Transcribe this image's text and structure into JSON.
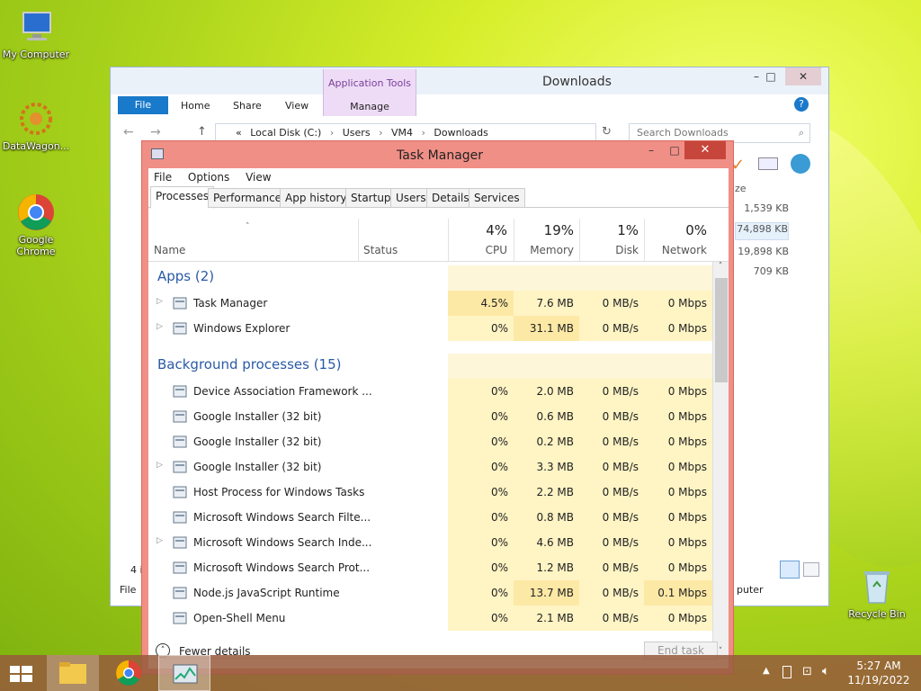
{
  "desktop": {
    "icons": [
      {
        "label": "My Computer"
      },
      {
        "label": "DataWagon..."
      },
      {
        "label": "Google Chrome"
      },
      {
        "label": "Recycle Bin"
      }
    ]
  },
  "explorer": {
    "title": "Downloads",
    "contextual_tab": "Application Tools",
    "tabs": [
      "File",
      "Home",
      "Share",
      "View",
      "Manage"
    ],
    "address": {
      "prefix": "«",
      "crumbs": [
        "Local Disk (C:)",
        "Users",
        "VM4",
        "Downloads"
      ]
    },
    "search_placeholder": "Search Downloads",
    "size_header": "ze",
    "sizes": [
      "1,539 KB",
      "74,898 KB",
      "19,898 KB",
      "709 KB"
    ],
    "status_count": "4 i",
    "status_right": "puter",
    "file_menu_letter": "File"
  },
  "taskmanager": {
    "title": "Task Manager",
    "menu": [
      "File",
      "Options",
      "View"
    ],
    "tabs": [
      "Processes",
      "Performance",
      "App history",
      "Startup",
      "Users",
      "Details",
      "Services"
    ],
    "selected_tab": "Processes",
    "columns": {
      "name": "Name",
      "status": "Status",
      "cpu": {
        "pct": "4%",
        "label": "CPU"
      },
      "memory": {
        "pct": "19%",
        "label": "Memory"
      },
      "disk": {
        "pct": "1%",
        "label": "Disk"
      },
      "network": {
        "pct": "0%",
        "label": "Network"
      }
    },
    "groups": {
      "apps": "Apps (2)",
      "background": "Background processes (15)"
    },
    "apps": [
      {
        "name": "Task Manager",
        "cpu": "4.5%",
        "mem": "7.6 MB",
        "disk": "0 MB/s",
        "net": "0 Mbps"
      },
      {
        "name": "Windows Explorer",
        "cpu": "0%",
        "mem": "31.1 MB",
        "disk": "0 MB/s",
        "net": "0 Mbps"
      }
    ],
    "background": [
      {
        "name": "Device Association Framework ...",
        "cpu": "0%",
        "mem": "2.0 MB",
        "disk": "0 MB/s",
        "net": "0 Mbps"
      },
      {
        "name": "Google Installer (32 bit)",
        "cpu": "0%",
        "mem": "0.6 MB",
        "disk": "0 MB/s",
        "net": "0 Mbps"
      },
      {
        "name": "Google Installer (32 bit)",
        "cpu": "0%",
        "mem": "0.2 MB",
        "disk": "0 MB/s",
        "net": "0 Mbps"
      },
      {
        "name": "Google Installer (32 bit)",
        "cpu": "0%",
        "mem": "3.3 MB",
        "disk": "0 MB/s",
        "net": "0 Mbps"
      },
      {
        "name": "Host Process for Windows Tasks",
        "cpu": "0%",
        "mem": "2.2 MB",
        "disk": "0 MB/s",
        "net": "0 Mbps"
      },
      {
        "name": "Microsoft Windows Search Filte...",
        "cpu": "0%",
        "mem": "0.8 MB",
        "disk": "0 MB/s",
        "net": "0 Mbps"
      },
      {
        "name": "Microsoft Windows Search Inde...",
        "cpu": "0%",
        "mem": "4.6 MB",
        "disk": "0 MB/s",
        "net": "0 Mbps"
      },
      {
        "name": "Microsoft Windows Search Prot...",
        "cpu": "0%",
        "mem": "1.2 MB",
        "disk": "0 MB/s",
        "net": "0 Mbps"
      },
      {
        "name": "Node.js JavaScript Runtime",
        "cpu": "0%",
        "mem": "13.7 MB",
        "disk": "0 MB/s",
        "net": "0.1 Mbps"
      },
      {
        "name": "Open-Shell Menu",
        "cpu": "0%",
        "mem": "2.1 MB",
        "disk": "0 MB/s",
        "net": "0 Mbps"
      }
    ],
    "fewer_details": "Fewer details",
    "end_task": "End task"
  },
  "taskbar": {
    "time": "5:27 AM",
    "date": "11/19/2022"
  }
}
